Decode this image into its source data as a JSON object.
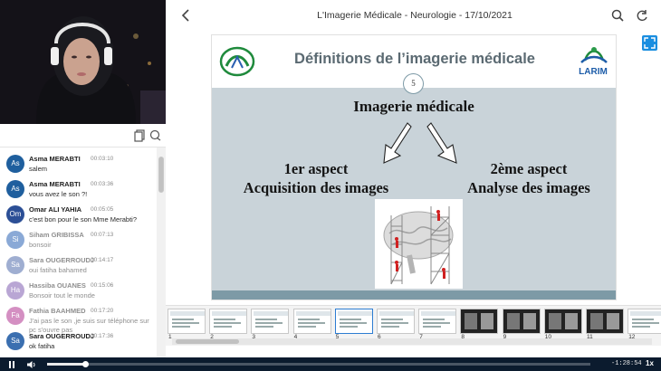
{
  "header": {
    "title": "L'Imagerie Médicale - Neurologie - 17/10/2021"
  },
  "chat": {
    "messages": [
      {
        "initials": "As",
        "author": "Asma MERABTI",
        "time": "00:03:10",
        "text": "salem",
        "color": "#1f5f9e",
        "grey": false
      },
      {
        "initials": "As",
        "author": "Asma MERABTI",
        "time": "00:03:36",
        "text": "vous avez le son ?!",
        "color": "#1f5f9e",
        "grey": false
      },
      {
        "initials": "Om",
        "author": "Omar ALI YAHIA",
        "time": "00:05:05",
        "text": "c'est bon pour le son Mme Merabti?",
        "color": "#2c4f96",
        "grey": false
      },
      {
        "initials": "Si",
        "author": "Siham GRIBISSA",
        "time": "00:07:13",
        "text": "bonsoir",
        "color": "#8aa9d6",
        "grey": true
      },
      {
        "initials": "Sa",
        "author": "Sara OUGERROUDJ",
        "time": "00:14:17",
        "text": "oui fatiha bahamed",
        "color": "#9faed1",
        "grey": true
      },
      {
        "initials": "Ha",
        "author": "Hassiba OUANES",
        "time": "00:15:06",
        "text": "Bonsoir tout le monde",
        "color": "#b9a6d4",
        "grey": true
      },
      {
        "initials": "Fa",
        "author": "Fathia BAAHMED",
        "time": "00:17:20",
        "text": "J'ai pas le son ,je suis sur téléphone sur pc s'ouvre pas",
        "color": "#d48fc2",
        "grey": true
      },
      {
        "initials": "Sa",
        "author": "Sara OUGERROUDJ",
        "time": "00:17:36",
        "text": "ok fatiha",
        "color": "#3b6fb0",
        "grey": false
      }
    ]
  },
  "slide": {
    "title": "Définitions de l’imagerie médicale",
    "page_number": "5",
    "main_term": "Imagerie médicale",
    "aspect1_line1": "1er aspect",
    "aspect1_line2": "Acquisition des images",
    "aspect2_line1": "2ème aspect",
    "aspect2_line2": "Analyse des images",
    "right_logo_text": "LARIM"
  },
  "thumbnails": {
    "selected": "5",
    "items": [
      {
        "num": "1",
        "dark": false
      },
      {
        "num": "2",
        "dark": false
      },
      {
        "num": "3",
        "dark": false
      },
      {
        "num": "4",
        "dark": false
      },
      {
        "num": "5",
        "dark": false
      },
      {
        "num": "6",
        "dark": false
      },
      {
        "num": "7",
        "dark": false
      },
      {
        "num": "8",
        "dark": true
      },
      {
        "num": "9",
        "dark": true
      },
      {
        "num": "10",
        "dark": true
      },
      {
        "num": "11",
        "dark": true
      },
      {
        "num": "12",
        "dark": false
      }
    ]
  },
  "player": {
    "remaining": "-1:28:54",
    "speed": "1x",
    "progress": 0.07
  },
  "icons": {
    "back": "chevron-left-icon",
    "search": "search-icon",
    "refresh": "refresh-icon",
    "expand": "expand-icon",
    "copy": "copy-icon",
    "chat": "chat-icon",
    "play": "pause-icon",
    "volume": "volume-icon"
  },
  "colors": {
    "accent": "#1a8ee0",
    "player_bg": "#0b1b2e",
    "slide_body": "#c9d3d9",
    "slide_footer": "#7d9aa6"
  }
}
